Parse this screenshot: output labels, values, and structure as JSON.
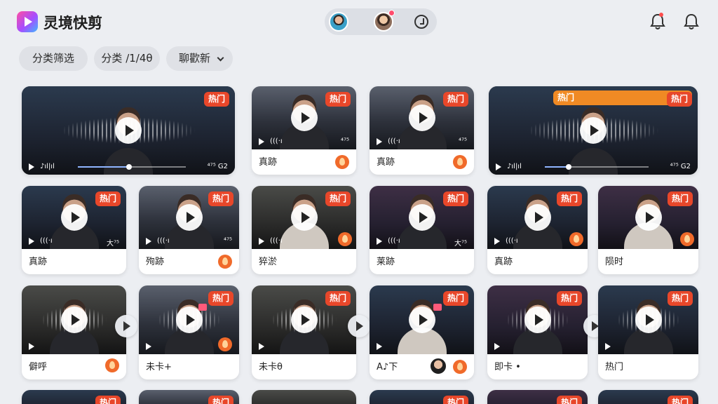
{
  "app": {
    "title": "灵境快剪"
  },
  "header": {
    "avatars": [
      "user-avatar-1",
      "user-avatar-2"
    ],
    "icons": [
      "timer-icon",
      "bell-icon",
      "bell-icon"
    ]
  },
  "filters": [
    {
      "label": "分类筛选"
    },
    {
      "label": "分类 /1/4θ"
    },
    {
      "label": "聊歡新"
    }
  ],
  "badges": {
    "hot": "热门"
  },
  "rows": [
    [
      {
        "caption": "",
        "hot": "热门",
        "time": "⁴⁷⁵ G2",
        "mini": "♪ıl|ıl",
        "progress": 0.45
      },
      {
        "caption": "真跡",
        "hot": "热门",
        "time": "⁴⁷⁵",
        "mini": "(((·ı"
      },
      {
        "caption": "真跡",
        "hot": "热门",
        "time": "⁴⁷⁵",
        "mini": "(((·ı"
      },
      {
        "caption": "",
        "hot": "热门",
        "hot2": "热门",
        "time": "⁴⁷⁵ G2",
        "mini": "♪ıl|ıl",
        "progress": 0.2
      }
    ],
    [
      {
        "caption": "真跡",
        "hot": "热门",
        "time": "大⁷⁵",
        "mini": "(((·ı"
      },
      {
        "caption": "殉跡",
        "hot": "热门",
        "time": "⁴⁷⁵",
        "mini": "(((·ı"
      },
      {
        "caption": "猝淤",
        "hot": "热门",
        "time": "",
        "mini": "(((·ı"
      },
      {
        "caption": "莱跡",
        "hot": "热门",
        "time": "大⁷⁵",
        "mini": "(((·ı"
      },
      {
        "caption": "真跡",
        "hot": "热门",
        "time": "",
        "mini": "(((·ı"
      },
      {
        "caption": "陨时",
        "hot": "热门",
        "time": "",
        "mini": ""
      }
    ],
    [
      {
        "caption": "僻呼",
        "hot": "",
        "time": "",
        "mini": ""
      },
      {
        "caption": "未卡+",
        "hot": "热门",
        "time": "",
        "mini": ""
      },
      {
        "caption": "未卡θ",
        "hot": "热门",
        "time": "",
        "mini": ""
      },
      {
        "caption": "A♪下",
        "hot": "热门",
        "time": "",
        "mini": ""
      },
      {
        "caption": "即卡 •",
        "hot": "热门",
        "time": "",
        "mini": ""
      },
      {
        "caption": "热门",
        "hot": "热门",
        "time": "",
        "mini": ""
      }
    ],
    [
      {
        "hot": "热门"
      },
      {
        "hot": "热门"
      },
      {
        "hot": ""
      },
      {
        "hot": "热门"
      },
      {
        "hot": "热门"
      },
      {
        "hot": "热门"
      }
    ]
  ]
}
